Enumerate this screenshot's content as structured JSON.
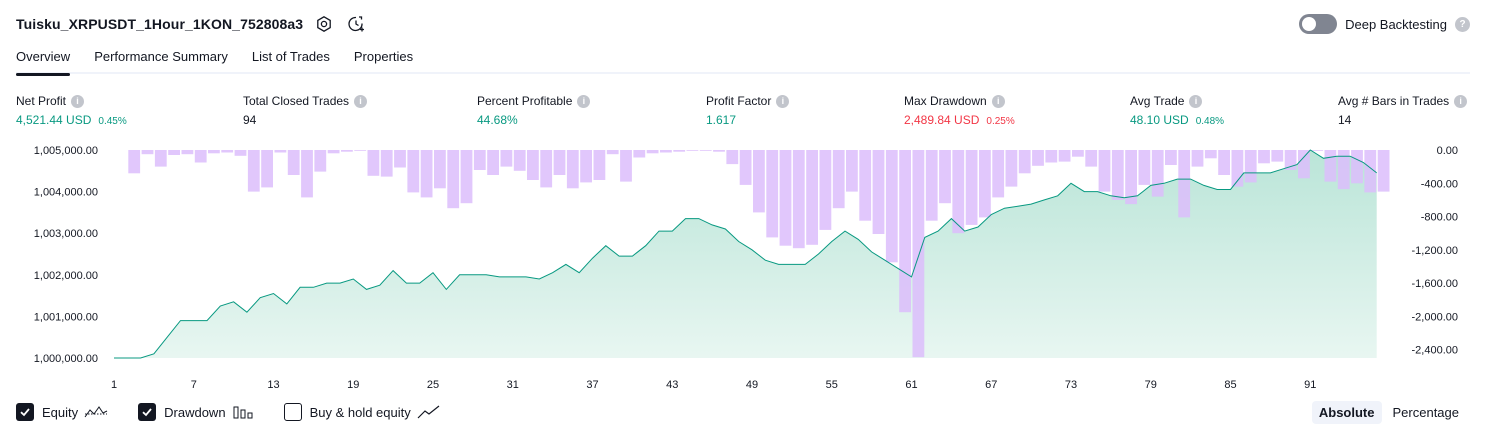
{
  "header": {
    "strategy_name": "Tuisku_XRPUSDT_1Hour_1KON_752808a3",
    "icons": [
      "settings-icon",
      "refresh-clock-icon"
    ]
  },
  "deep_backtesting": {
    "label": "Deep Backtesting",
    "enabled": false,
    "help": "?"
  },
  "tabs": [
    {
      "label": "Overview",
      "active": true
    },
    {
      "label": "Performance Summary",
      "active": false
    },
    {
      "label": "List of Trades",
      "active": false
    },
    {
      "label": "Properties",
      "active": false
    }
  ],
  "metrics": [
    {
      "label": "Net Profit",
      "value": "4,521.44 USD",
      "sub": "0.45%",
      "tone": "pos"
    },
    {
      "label": "Total Closed Trades",
      "value": "94",
      "sub": "",
      "tone": "neutral"
    },
    {
      "label": "Percent Profitable",
      "value": "44.68%",
      "sub": "",
      "tone": "pos"
    },
    {
      "label": "Profit Factor",
      "value": "1.617",
      "sub": "",
      "tone": "pos"
    },
    {
      "label": "Max Drawdown",
      "value": "2,489.84 USD",
      "sub": "0.25%",
      "tone": "neg"
    },
    {
      "label": "Avg Trade",
      "value": "48.10 USD",
      "sub": "0.48%",
      "tone": "pos"
    },
    {
      "label": "Avg # Bars in Trades",
      "value": "14",
      "sub": "",
      "tone": "neutral"
    }
  ],
  "legend": [
    {
      "label": "Equity",
      "checked": true,
      "icon": "equity-line-icon"
    },
    {
      "label": "Drawdown",
      "checked": true,
      "icon": "drawdown-bars-icon"
    },
    {
      "label": "Buy & hold equity",
      "checked": false,
      "icon": "buy-hold-line-icon"
    }
  ],
  "modes": [
    {
      "label": "Absolute",
      "active": true
    },
    {
      "label": "Percentage",
      "active": false
    }
  ],
  "colors": {
    "equity_line": "#089981",
    "equity_fill": "#c8ebe1",
    "drawdown_bar": "#dcbdfb",
    "positive": "#089981",
    "negative": "#f23645"
  },
  "chart_data": {
    "type": "area",
    "x_ticks": [
      "1",
      "7",
      "13",
      "19",
      "25",
      "31",
      "37",
      "43",
      "49",
      "55",
      "61",
      "67",
      "73",
      "79",
      "85",
      "91"
    ],
    "y_left_ticks": [
      "1,005,000.00",
      "1,004,000.00",
      "1,003,000.00",
      "1,002,000.00",
      "1,001,000.00",
      "1,000,000.00"
    ],
    "y_right_ticks": [
      "0.00",
      "-400.00",
      "-800.00",
      "-1,200.00",
      "-1,600.00",
      "-2,000.00",
      "-2,400.00"
    ],
    "y_left_range": [
      1000000,
      1005000
    ],
    "y_right_range": [
      -2500,
      0
    ],
    "equity": [
      1000000,
      1000000,
      1000000,
      1000100,
      1000500,
      1000900,
      1000900,
      1000900,
      1001250,
      1001350,
      1001100,
      1001450,
      1001550,
      1001300,
      1001700,
      1001700,
      1001800,
      1001800,
      1001900,
      1001650,
      1001750,
      1002100,
      1001800,
      1001800,
      1002050,
      1001650,
      1002000,
      1002000,
      1002000,
      1001950,
      1001950,
      1001950,
      1001900,
      1002050,
      1002250,
      1002050,
      1002400,
      1002700,
      1002450,
      1002450,
      1002700,
      1003050,
      1003050,
      1003350,
      1003350,
      1003200,
      1003100,
      1002800,
      1002600,
      1002350,
      1002250,
      1002250,
      1002250,
      1002500,
      1002800,
      1003050,
      1002850,
      1002550,
      1002350,
      1002150,
      1001950,
      1002900,
      1003050,
      1003350,
      1003050,
      1003150,
      1003450,
      1003600,
      1003650,
      1003700,
      1003800,
      1003900,
      1004200,
      1004000,
      1004000,
      1003900,
      1003850,
      1003900,
      1004150,
      1004200,
      1004300,
      1004300,
      1004150,
      1004050,
      1004050,
      1004450,
      1004450,
      1004450,
      1004550,
      1004650,
      1005000,
      1004800,
      1004850,
      1004850,
      1004700,
      1004450
    ],
    "drawdown": [
      0,
      -280,
      -50,
      -200,
      -60,
      -50,
      -150,
      -40,
      -30,
      -70,
      -500,
      -450,
      -30,
      -300,
      -570,
      -260,
      -40,
      -20,
      -10,
      -310,
      -320,
      -210,
      -510,
      -570,
      -460,
      -700,
      -640,
      -240,
      -300,
      -200,
      -250,
      -360,
      -450,
      -300,
      -460,
      -390,
      -360,
      -50,
      -380,
      -90,
      -40,
      -30,
      -20,
      -10,
      -10,
      -20,
      -170,
      -420,
      -750,
      -1050,
      -1150,
      -1180,
      -1140,
      -960,
      -700,
      -500,
      -850,
      -1010,
      -1350,
      -1950,
      -2490,
      -850,
      -640,
      -1000,
      -900,
      -810,
      -570,
      -440,
      -280,
      -190,
      -150,
      -140,
      -80,
      -200,
      -500,
      -600,
      -650,
      -420,
      -560,
      -180,
      -810,
      -200,
      -100,
      -300,
      -440,
      -390,
      -160,
      -140,
      -240,
      -340,
      -10,
      -380,
      -470,
      -400,
      -510,
      -500
    ]
  }
}
